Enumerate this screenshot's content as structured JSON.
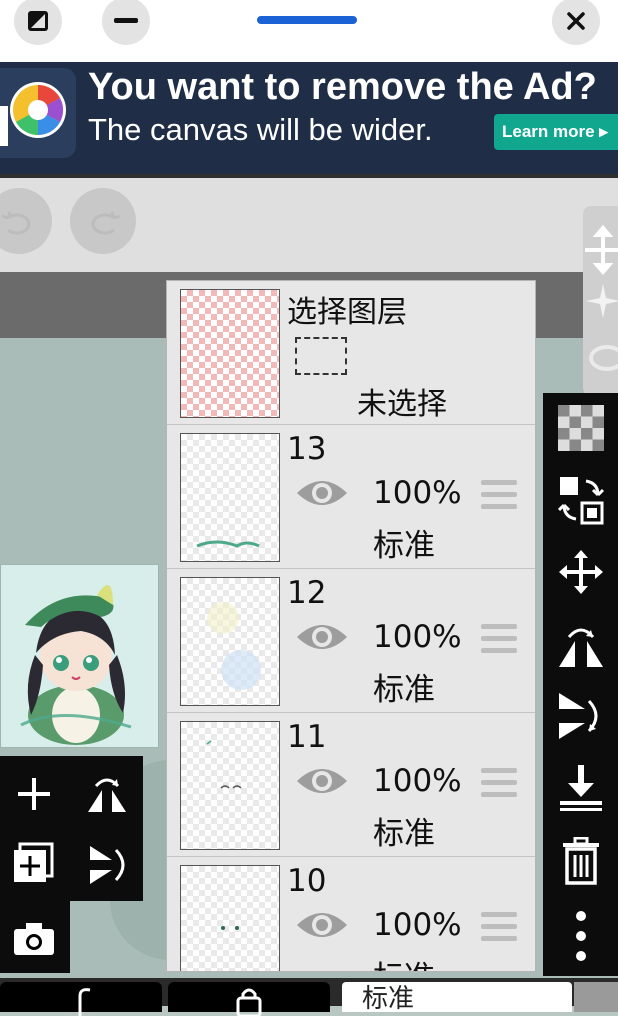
{
  "topbar": {
    "icons": [
      "resize-window-icon",
      "minimize-icon",
      "close-icon"
    ]
  },
  "ad": {
    "title": "You want to remove the Ad?",
    "subtitle": "The canvas will be wider.",
    "learn_more": "Learn more ▸"
  },
  "layer_panel": {
    "selection": {
      "title": "选择图层",
      "status": "未选择"
    },
    "layers": [
      {
        "number": "13",
        "opacity": "100%",
        "blend": "标准"
      },
      {
        "number": "12",
        "opacity": "100%",
        "blend": "标准"
      },
      {
        "number": "11",
        "opacity": "100%",
        "blend": "标准"
      },
      {
        "number": "10",
        "opacity": "100%",
        "blend": "标准"
      }
    ]
  },
  "bottom": {
    "blend_mode": "标准"
  },
  "colors": {
    "accent": "#1a62d6",
    "ad_bg": "#1f2e46",
    "learn_more_bg": "#11a78f",
    "toolbar": "#0c0c0c"
  }
}
